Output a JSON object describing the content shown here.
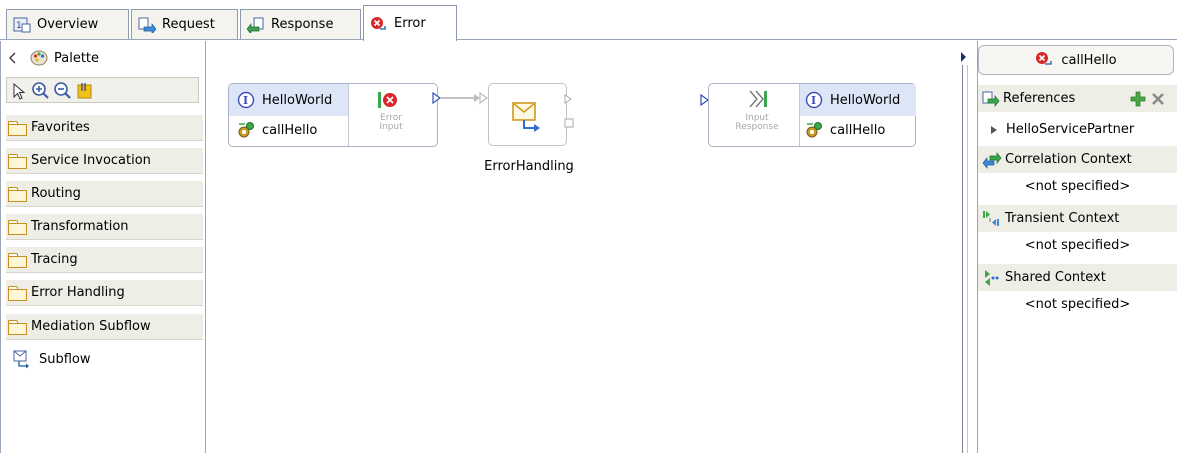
{
  "tabs": [
    {
      "label": "Overview",
      "icon": "overview-icon"
    },
    {
      "label": "Request",
      "icon": "request-icon"
    },
    {
      "label": "Response",
      "icon": "response-icon"
    },
    {
      "label": "Error",
      "icon": "error-icon",
      "active": true
    }
  ],
  "palette": {
    "title": "Palette",
    "drawers": [
      "Favorites",
      "Service Invocation",
      "Routing",
      "Transformation",
      "Tracing",
      "Error Handling",
      "Mediation Subflow"
    ],
    "subflow_label": "Subflow"
  },
  "canvas": {
    "input_node": {
      "interface": "HelloWorld",
      "operation": "callHello",
      "terminal_label": "Error\nInput"
    },
    "error_handling_label": "ErrorHandling",
    "response_node": {
      "terminal_label": "Input\nResponse",
      "interface": "HelloWorld",
      "operation": "callHello"
    }
  },
  "props": {
    "title": "callHello",
    "references": {
      "label": "References",
      "item": "HelloServicePartner"
    },
    "correlation": {
      "label": "Correlation Context",
      "value": "<not specified>"
    },
    "transient": {
      "label": "Transient Context",
      "value": "<not specified>"
    },
    "shared": {
      "label": "Shared Context",
      "value": "<not specified>"
    }
  },
  "colors": {
    "accent_blue": "#dce6f7",
    "error_red": "#d8282a",
    "folder_orange": "#c7901e",
    "frame": "#9aa6b8"
  }
}
